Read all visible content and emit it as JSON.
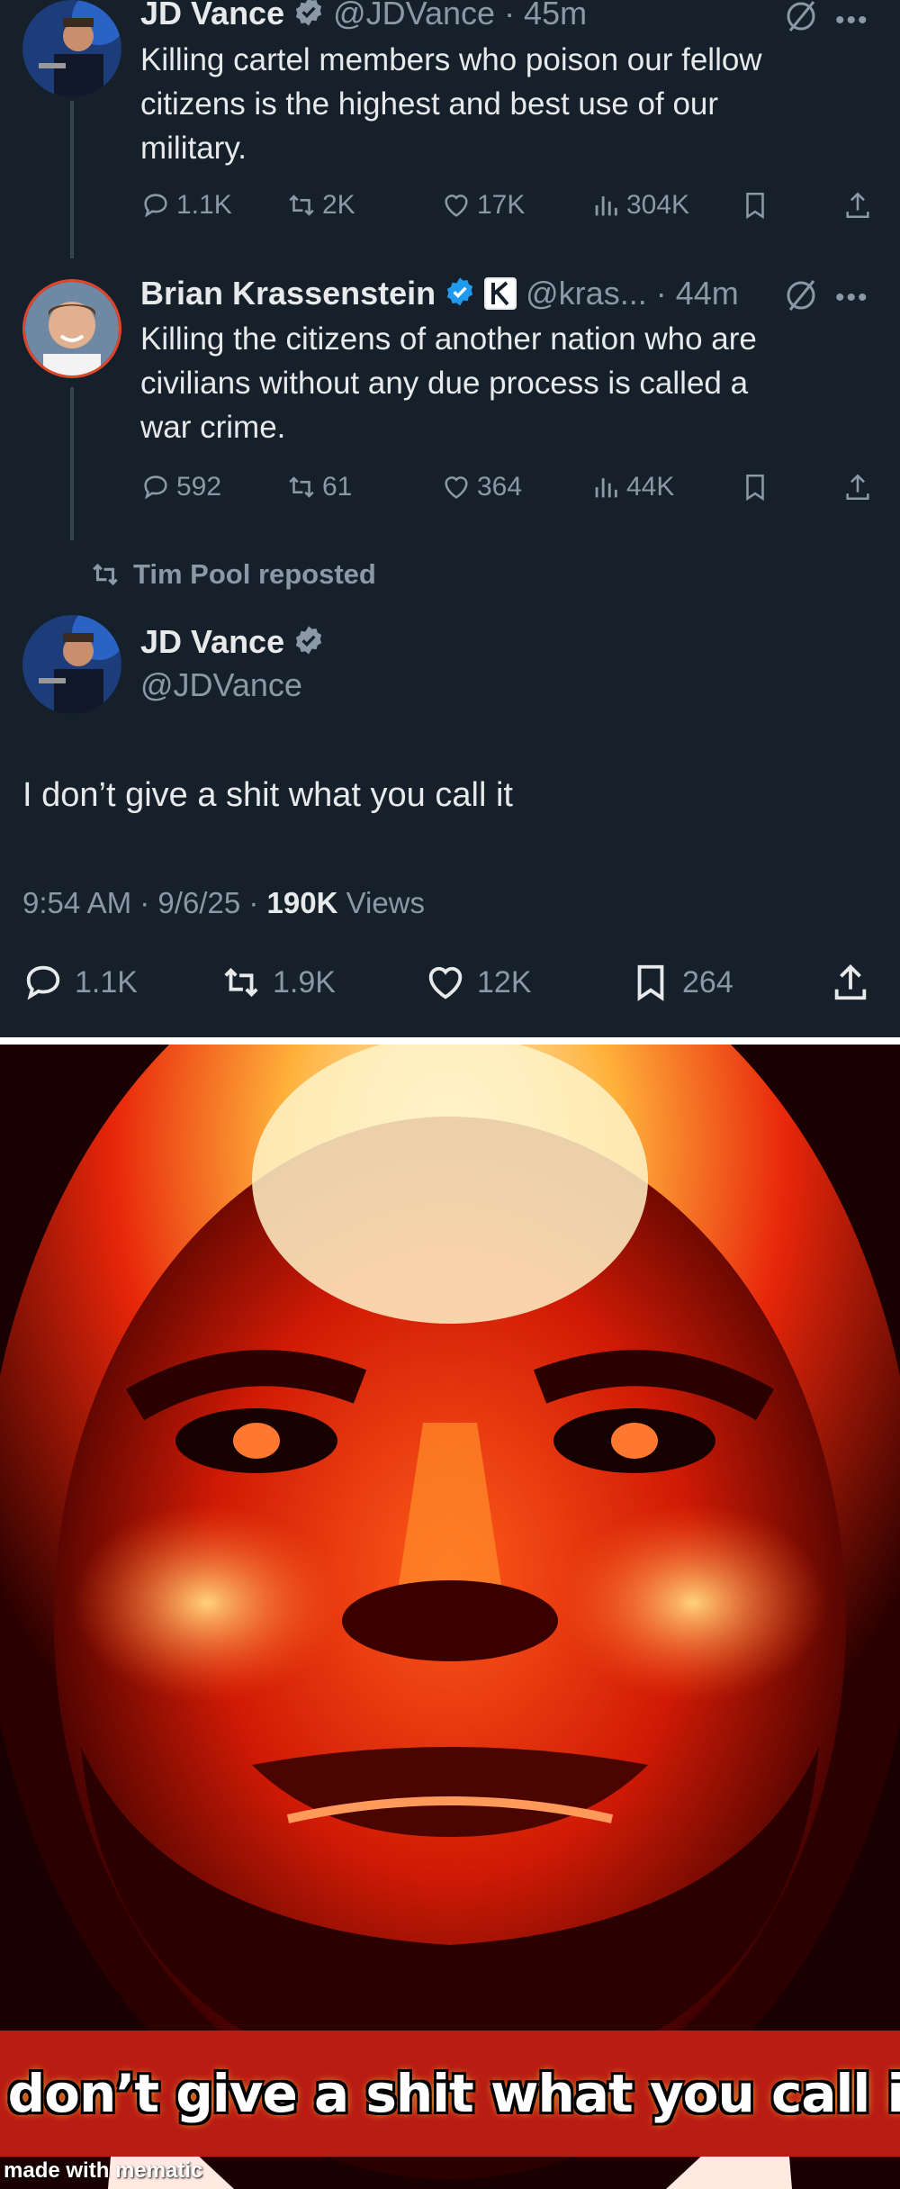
{
  "tweet1": {
    "name": "JD Vance",
    "handle": "@JDVance",
    "time": "· 45m",
    "text_lines": [
      "Killing cartel members who poison our fellow",
      "citizens is the highest and best use of our",
      "military."
    ],
    "replies": "1.1K",
    "reposts": "2K",
    "likes": "17K",
    "views": "304K"
  },
  "tweet2": {
    "name": "Brian Krassenstein",
    "handle": "@kras...",
    "time": "· 44m",
    "text_lines": [
      "Killing the citizens of another nation who are",
      "civilians without any due process is called a",
      "war crime."
    ],
    "replies": "592",
    "reposts": "61",
    "likes": "364",
    "views": "44K"
  },
  "repost_label": "Tim Pool reposted",
  "main_tweet": {
    "name": "JD Vance",
    "handle": "@JDVance",
    "text": "I don’t give a shit what you call it",
    "time": "9:54 AM",
    "date": "9/6/25",
    "views_count": "190K",
    "views_label": "Views",
    "replies": "1.1K",
    "reposts": "1.9K",
    "likes": "12K",
    "bookmarks": "264"
  },
  "meme": {
    "caption": "I don’t give a shit what you call it",
    "watermark": "made with mematic"
  },
  "colors": {
    "background": "#15202b",
    "verified": "#8b98a5",
    "meme_red": "#b91c13"
  }
}
